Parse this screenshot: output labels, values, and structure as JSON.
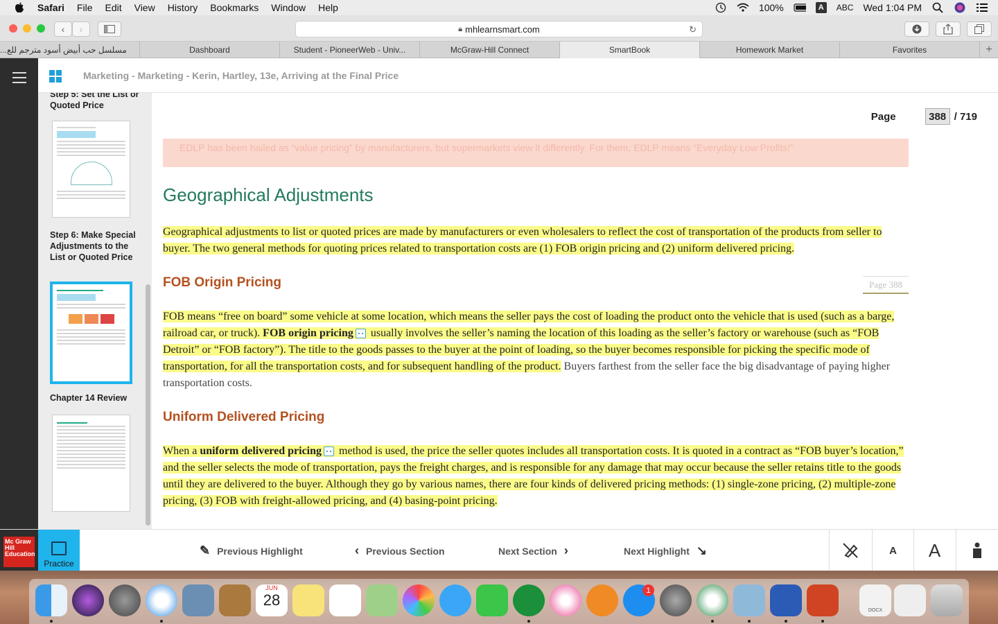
{
  "menubar": {
    "app": "Safari",
    "items": [
      "File",
      "Edit",
      "View",
      "History",
      "Bookmarks",
      "Window",
      "Help"
    ],
    "battery": "100%",
    "input_source": "ABC",
    "clock": "Wed 1:04 PM"
  },
  "browser": {
    "url": "mhlearnsmart.com",
    "tabs": [
      {
        "label": "مسلسل حب أبيض أسود مترجم للع..."
      },
      {
        "label": "Dashboard"
      },
      {
        "label": "Student - PioneerWeb - Univ..."
      },
      {
        "label": "McGraw-Hill Connect"
      },
      {
        "label": "SmartBook",
        "active": true
      },
      {
        "label": "Homework Market"
      },
      {
        "label": "Favorites"
      }
    ],
    "new_tab": "+"
  },
  "app": {
    "breadcrumb": "Marketing - Marketing - Kerin, Hartley, 13e, Arriving at the Final Price"
  },
  "sidebar": {
    "items": [
      {
        "title": "Step 5: Set the List or Quoted Price"
      },
      {
        "title": "Step 6: Make Special Adjustments  to the List or Quoted Price",
        "selected": true
      },
      {
        "title": "Chapter 14 Review"
      }
    ]
  },
  "page": {
    "label": "Page",
    "current": "388",
    "total": "/ 719",
    "page_tag": "Page 388"
  },
  "content": {
    "top_note": "EDLP has been hailed as “value pricing” by manufacturers, but supermarkets view it differently. For them, EDLP means “Everyday Low Profits!”",
    "heading": "Geographical Adjustments",
    "intro": "Geographical adjustments to list or quoted prices are made by manufacturers or even wholesalers to reflect the cost of transportation of the products from seller to buyer. The two general methods for quoting prices related to transportation costs are (1) FOB origin pricing and (2) uniform delivered pricing.",
    "fob_heading": "FOB Origin Pricing",
    "fob_p1": "FOB means “free on board” some vehicle at some location, which means the seller pays the cost of loading the product onto the vehicle that is used (such as a barge, railroad car, or truck). ",
    "fob_term": "FOB origin pricing",
    "fob_p2": " usually involves the seller’s naming the location of this loading as the seller’s factory or warehouse (such as “FOB Detroit” or “FOB factory”). The title to the goods passes to the buyer at the point of loading, so the buyer becomes responsible for picking the specific mode of transportation, for all the transportation costs, and for subsequent handling of the product.",
    "fob_p3": " Buyers farthest from the seller face the big disadvantage of paying higher transportation costs.",
    "udp_heading": "Uniform Delivered Pricing",
    "udp_p1": "When a ",
    "udp_term": "uniform delivered pricing",
    "udp_p2": " method is used, the price the seller quotes includes all transportation costs. It is quoted in a contract as “FOB buyer’s location,” and the seller selects the mode of transportation, pays the freight charges, and is responsible for any damage that may occur because the seller retains title to the goods until they are delivered to the buyer. Although they go by various names, there are four kinds of delivered pricing methods: (1) single-zone pricing, (2) multiple-zone pricing, (3) FOB with freight-allowed pricing, and (4) basing-point pricing."
  },
  "bottombar": {
    "logo": "Mc Graw Hill Education",
    "practice": "Practice",
    "prev_highlight": "Previous Highlight",
    "prev_section": "Previous Section",
    "next_section": "Next Section",
    "next_highlight": "Next Highlight",
    "font_small": "A",
    "font_large": "A"
  },
  "dock": {
    "calendar_month": "JUN",
    "calendar_day": "28",
    "appstore_badge": "1",
    "docx_label": "DOCX"
  },
  "colors": {
    "accent": "#1fb4ec",
    "heading_green": "#237a5c",
    "subheading": "#b4511f",
    "highlight": "#fbfb8a",
    "note_bg": "#fbd8ce",
    "mh_red": "#d6251f"
  }
}
